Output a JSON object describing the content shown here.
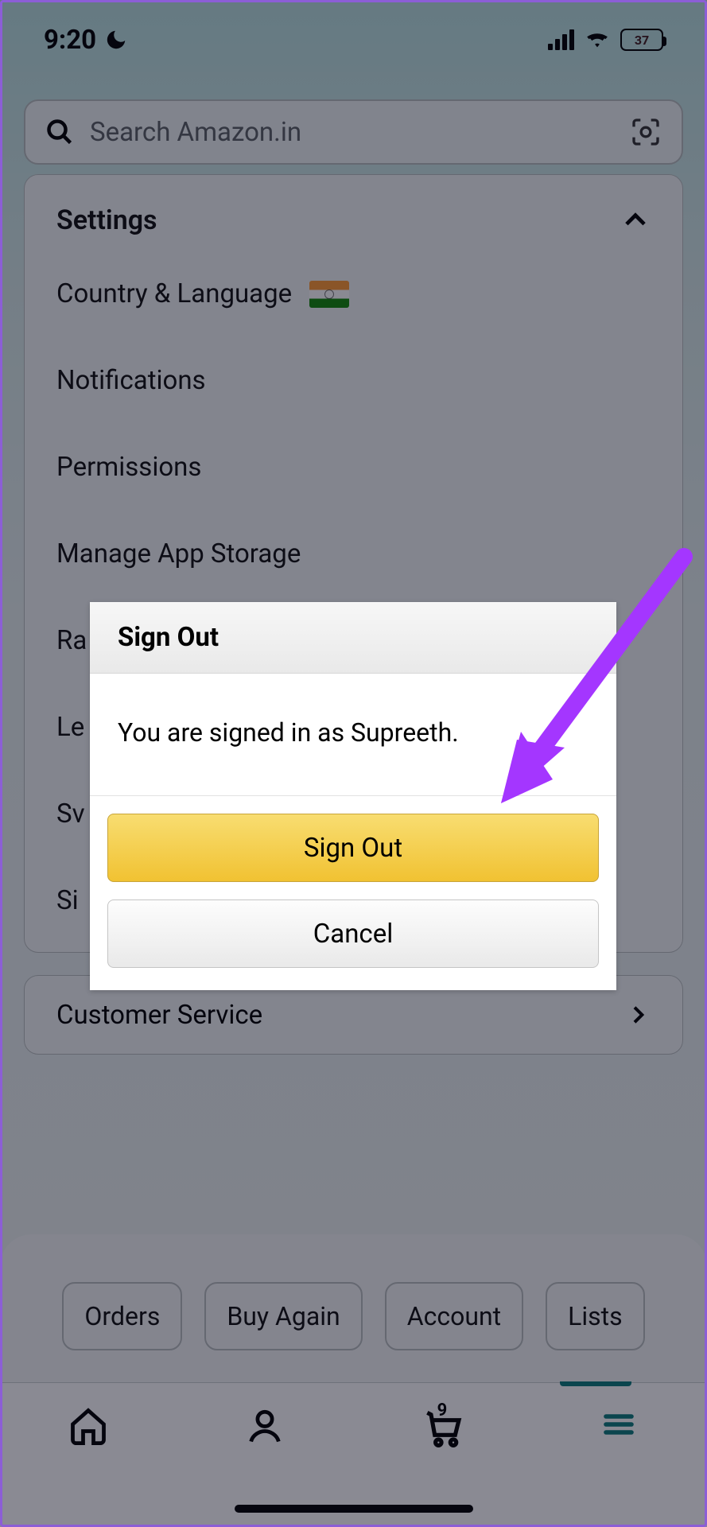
{
  "status": {
    "time": "9:20",
    "battery_pct": "37"
  },
  "search": {
    "placeholder": "Search Amazon.in"
  },
  "settings": {
    "header": "Settings",
    "items": {
      "country_language": "Country & Language",
      "notifications": "Notifications",
      "permissions": "Permissions",
      "manage_storage": "Manage App Storage",
      "item5_partial": "Ra",
      "item6_partial": "Le",
      "item7_partial": "Sv",
      "item8_partial": "Si"
    }
  },
  "customer_service": "Customer Service",
  "quick_links": {
    "orders": "Orders",
    "buy_again": "Buy Again",
    "account": "Account",
    "lists": "Lists"
  },
  "tabbar": {
    "cart_count": "9"
  },
  "modal": {
    "title": "Sign Out",
    "message": "You are signed in as Supreeth.",
    "primary": "Sign Out",
    "secondary": "Cancel"
  }
}
